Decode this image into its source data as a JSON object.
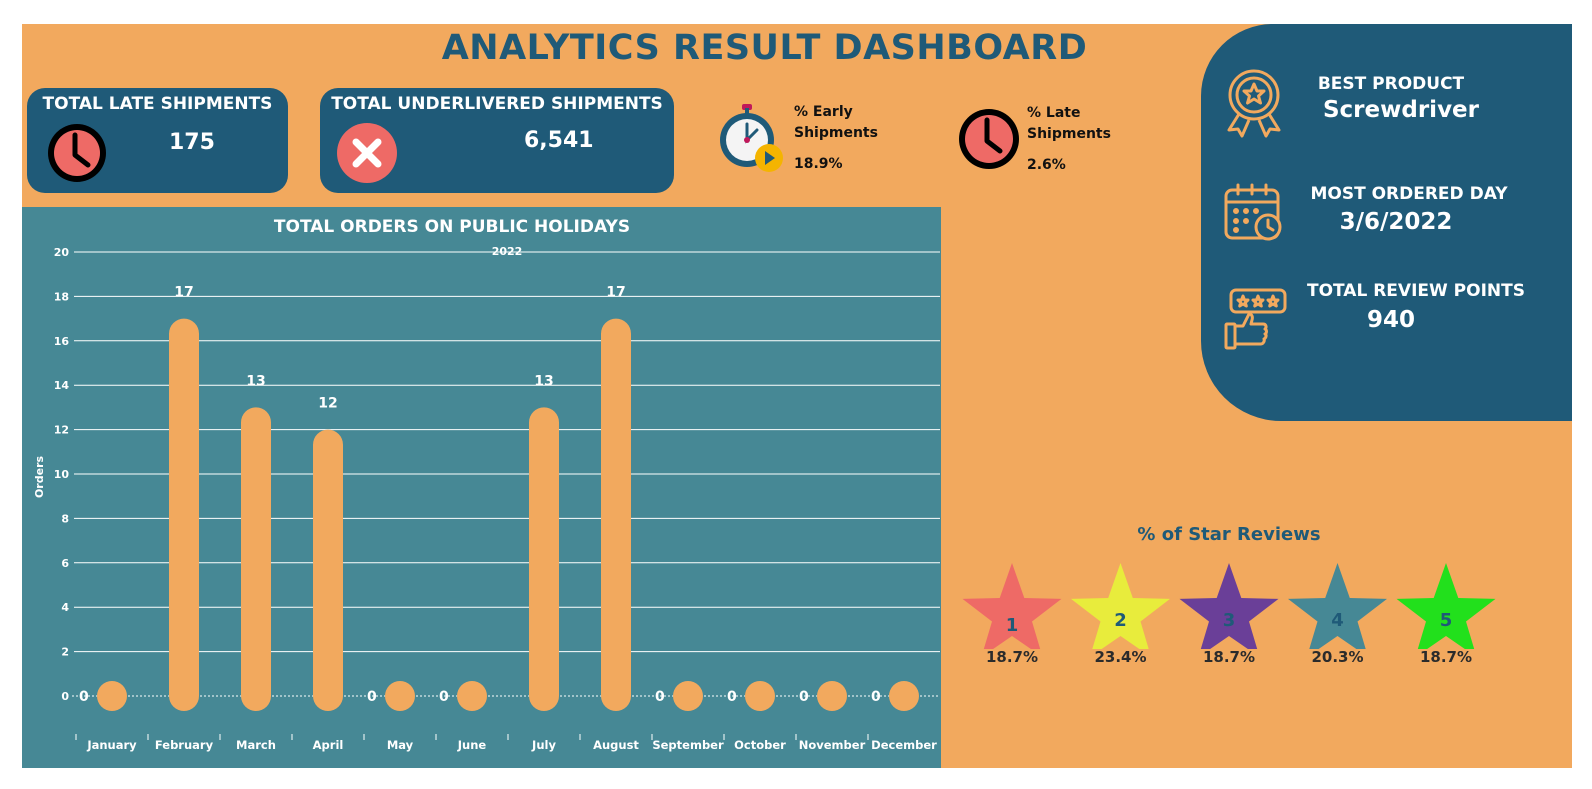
{
  "header": {
    "title": "ANALYTICS RESULT DASHBOARD"
  },
  "kpis": {
    "late": {
      "label": "TOTAL LATE SHIPMENTS",
      "value": "175",
      "icon": "clock-icon"
    },
    "underdelivered": {
      "label": "TOTAL UNDERLIVERED SHIPMENTS",
      "value": "6,541",
      "icon": "close-x-icon"
    },
    "early_pct": {
      "label_line1": "% Early",
      "label_line2": "Shipments",
      "value": "18.9%",
      "icon": "stopwatch-icon"
    },
    "late_pct": {
      "label_line1": "% Late",
      "label_line2": "Shipments",
      "value": "2.6%",
      "icon": "clock-icon"
    }
  },
  "summary": {
    "best_product": {
      "label": "BEST PRODUCT",
      "value": "Screwdriver",
      "icon": "award-ribbon-icon"
    },
    "most_ordered_day": {
      "label": "MOST ORDERED DAY",
      "value": "3/6/2022",
      "icon": "calendar-clock-icon"
    },
    "review_points": {
      "label": "TOTAL REVIEW POINTS",
      "value": "940",
      "icon": "thumbs-up-stars-icon"
    }
  },
  "star_reviews": {
    "title": "% of Star Reviews",
    "items": [
      {
        "rating": "1",
        "percent": "18.7%",
        "color": "#ee6a66"
      },
      {
        "rating": "2",
        "percent": "23.4%",
        "color": "#e8ec3c"
      },
      {
        "rating": "3",
        "percent": "18.7%",
        "color": "#6a3f98"
      },
      {
        "rating": "4",
        "percent": "20.3%",
        "color": "#468895"
      },
      {
        "rating": "5",
        "percent": "18.7%",
        "color": "#22e01c"
      }
    ]
  },
  "colors": {
    "background": "#f2a95e",
    "panel": "#1f5a78",
    "chart_panel": "#468895",
    "bar": "#f2a95e",
    "icon_red": "#ee6a66"
  },
  "chart_data": {
    "type": "bar",
    "title": "TOTAL ORDERS ON PUBLIC HOLIDAYS",
    "subtitle": "2022",
    "ylabel": "Orders",
    "xlabel": "",
    "ylim": [
      0,
      20
    ],
    "yticks": [
      0,
      2,
      4,
      6,
      8,
      10,
      12,
      14,
      16,
      18,
      20
    ],
    "grid": true,
    "categories": [
      "January",
      "February",
      "March",
      "April",
      "May",
      "June",
      "July",
      "August",
      "September",
      "October",
      "November",
      "December"
    ],
    "values": [
      0,
      17,
      13,
      12,
      0,
      0,
      13,
      17,
      0,
      0,
      0,
      0
    ]
  }
}
